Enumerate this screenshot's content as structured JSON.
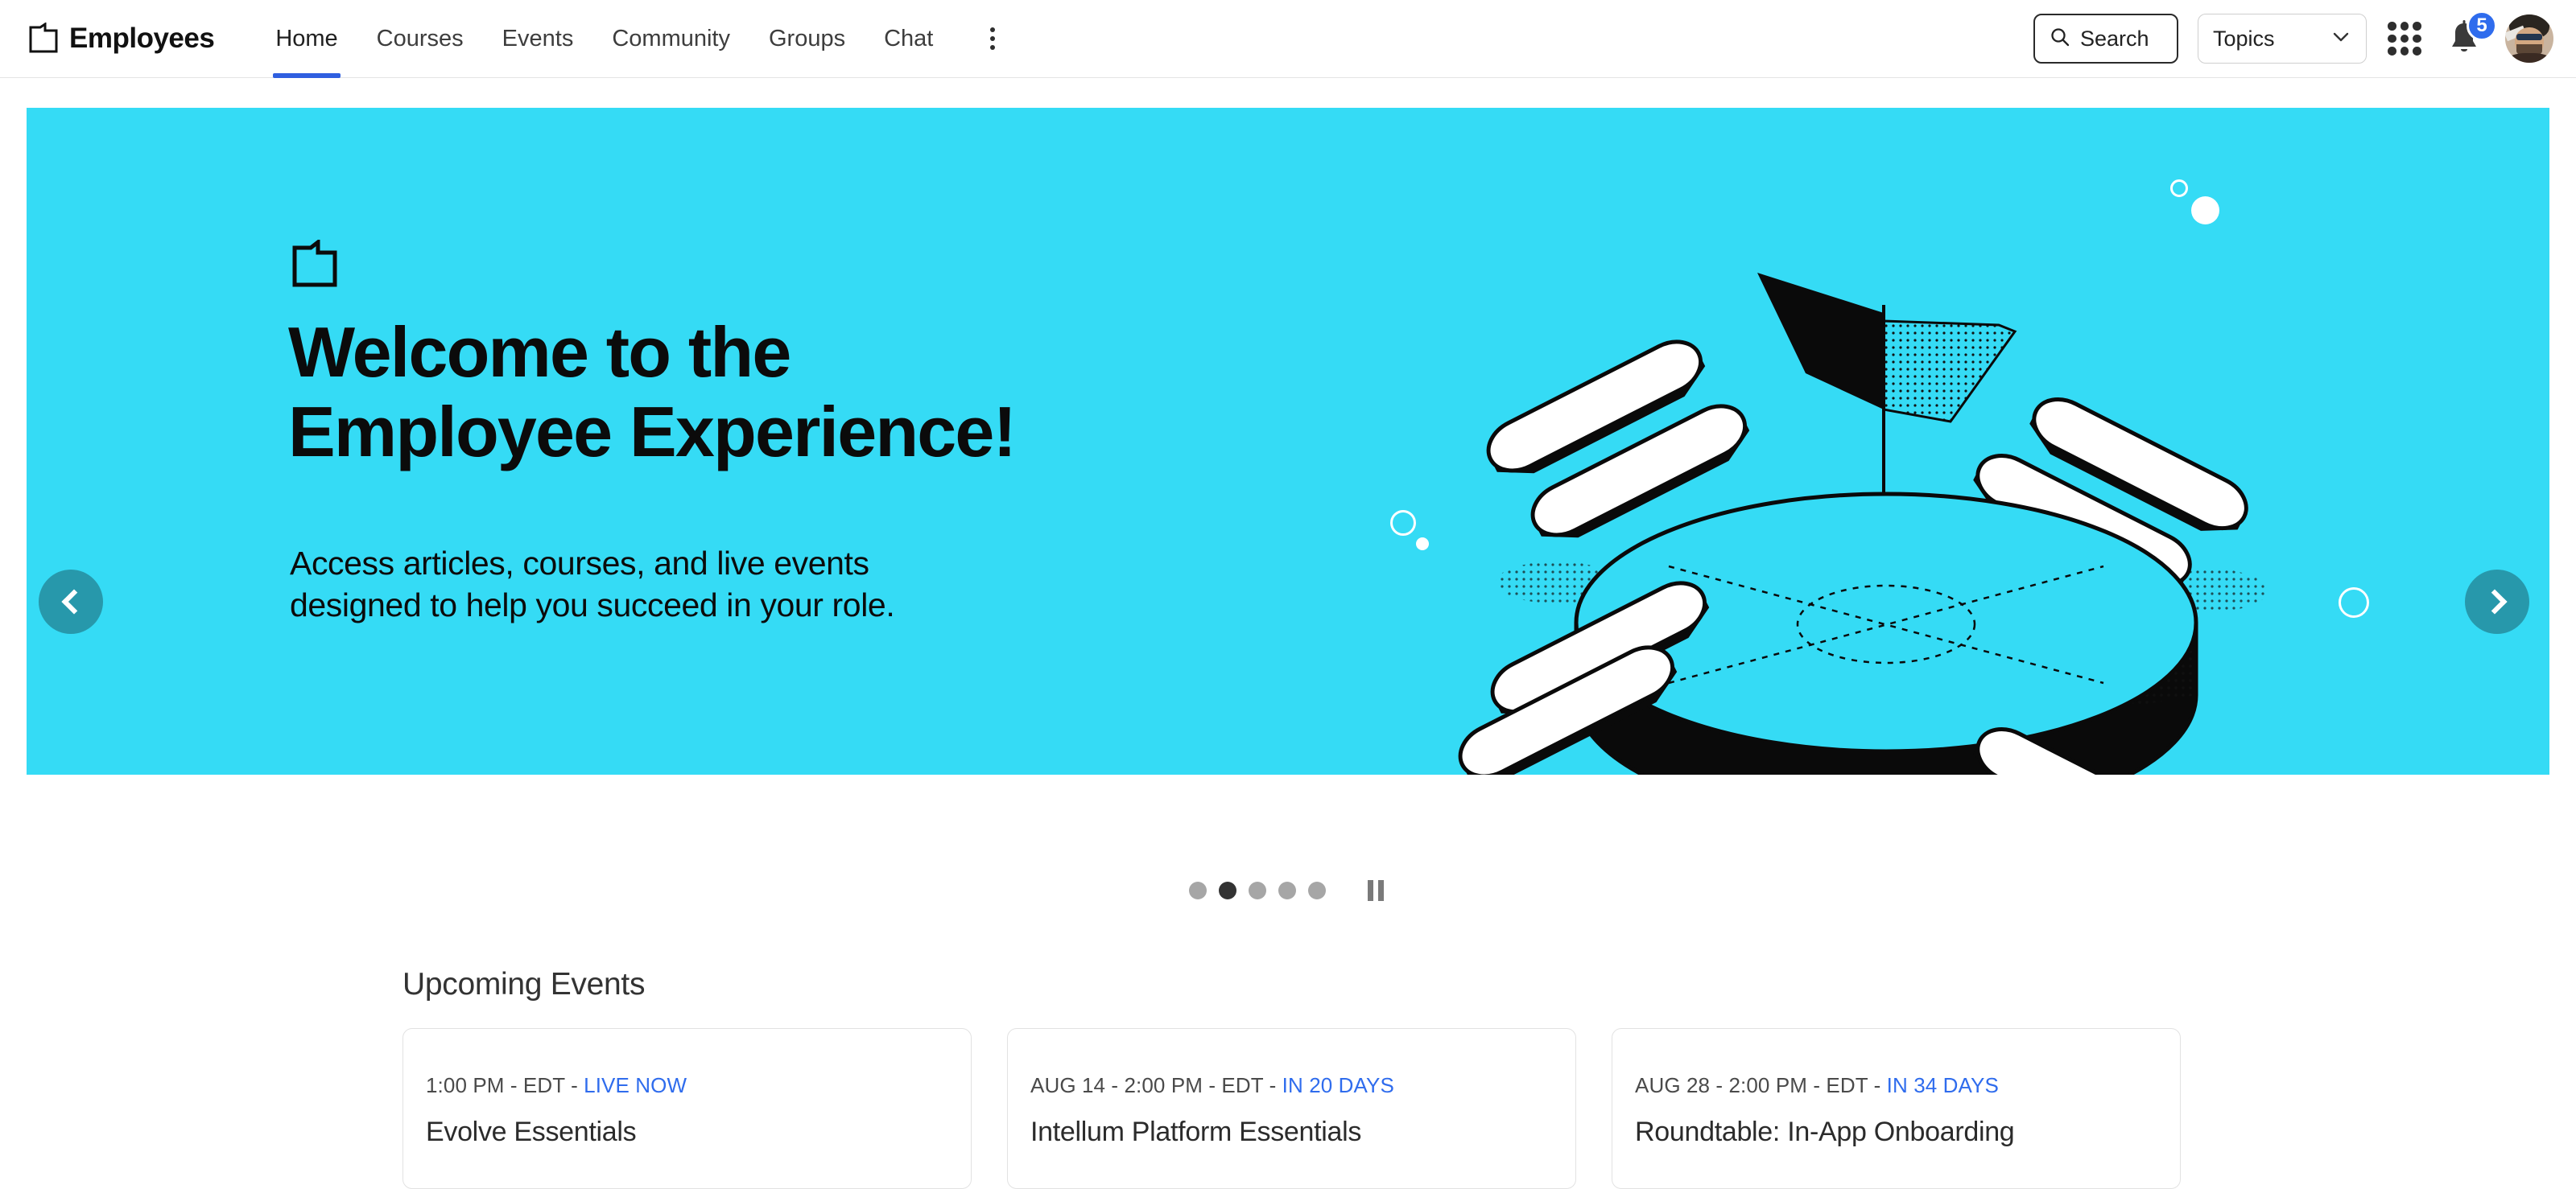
{
  "header": {
    "brand": {
      "name": "Employees",
      "logo_icon": "page-corner-logo-icon"
    },
    "nav": [
      {
        "label": "Home",
        "active": true
      },
      {
        "label": "Courses",
        "active": false
      },
      {
        "label": "Events",
        "active": false
      },
      {
        "label": "Community",
        "active": false
      },
      {
        "label": "Groups",
        "active": false
      },
      {
        "label": "Chat",
        "active": false
      }
    ],
    "more_icon": "kebab-menu-icon",
    "search": {
      "label": "Search",
      "icon": "search-icon"
    },
    "topics": {
      "label": "Topics",
      "icon": "chevron-down-icon"
    },
    "apps_icon": "apps-grid-icon",
    "notifications": {
      "icon": "bell-icon",
      "count": "5",
      "badge_color": "#2f6ced"
    },
    "avatar_name": "user-avatar"
  },
  "hero": {
    "background_color": "#35dbf5",
    "logo_icon": "page-corner-logo-icon",
    "title_line1": "Welcome to the",
    "title_line2": "Employee Experience!",
    "subtitle_line1": "Access articles, courses, and live events",
    "subtitle_line2": "designed to help you succeed in your role.",
    "prev_label": "Previous slide",
    "next_label": "Next slide",
    "illustration": "isometric-round-table-with-benches-and-flag"
  },
  "carousel": {
    "slides": 5,
    "active_index": 1,
    "pause_label": "Pause carousel",
    "active_dot_color": "#333333",
    "dot_color": "#a6a6a6"
  },
  "upcoming": {
    "title": "Upcoming Events",
    "accent_color": "#2f6ced",
    "events": [
      {
        "meta_prefix": "1:00 PM - EDT - ",
        "meta_status": "LIVE NOW",
        "title": "Evolve Essentials"
      },
      {
        "meta_prefix": "AUG 14 - 2:00 PM - EDT - ",
        "meta_status": "IN 20 DAYS",
        "title": "Intellum Platform Essentials"
      },
      {
        "meta_prefix": "AUG 28 - 2:00 PM - EDT - ",
        "meta_status": "IN 34 DAYS",
        "title": "Roundtable: In-App Onboarding"
      }
    ]
  }
}
